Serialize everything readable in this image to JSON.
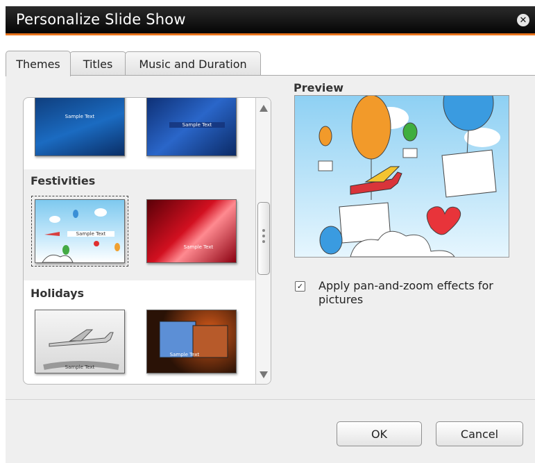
{
  "window": {
    "title": "Personalize Slide Show",
    "close_icon": "close-icon"
  },
  "tabs": [
    {
      "label": "Themes",
      "active": true
    },
    {
      "label": "Titles",
      "active": false
    },
    {
      "label": "Music and Duration",
      "active": false
    }
  ],
  "themes": {
    "groups": [
      {
        "label": "",
        "thumbnails": [
          {
            "caption": "Sample Text"
          },
          {
            "caption": "Sample Text"
          }
        ]
      },
      {
        "label": "Festivities",
        "thumbnails": [
          {
            "caption": "Sample Text",
            "selected": true
          },
          {
            "caption": "Sample Text"
          }
        ]
      },
      {
        "label": "Holidays",
        "thumbnails": [
          {
            "caption": "Sample Text"
          },
          {
            "caption": "Sample Text"
          }
        ]
      }
    ]
  },
  "preview": {
    "label": "Preview"
  },
  "options": {
    "pan_zoom_label": "Apply pan-and-zoom effects for pictures",
    "pan_zoom_checked": true,
    "check_mark": "✓"
  },
  "buttons": {
    "ok": "OK",
    "cancel": "Cancel"
  },
  "colors": {
    "accent": "#e8731c",
    "titlebar": "#111111"
  }
}
